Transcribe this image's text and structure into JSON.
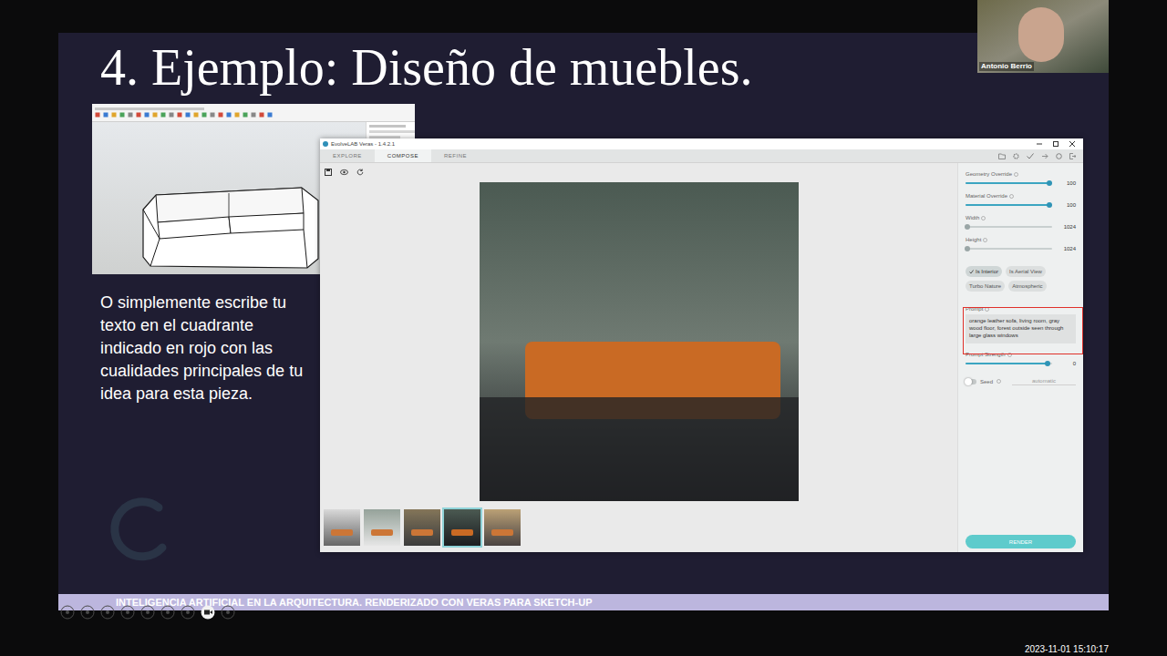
{
  "meeting": {
    "presenter": "Antonio Berrio",
    "timestamp": "2023-11-01  15:10:17"
  },
  "slide": {
    "title": "4. Ejemplo: Diseño de muebles.",
    "body": "O simplemente escribe tu texto en el cuadrante indicado en rojo con las cualidades principales de tu idea para esta pieza.",
    "footer": "INTELIGENCIA ARTIFICIAL EN LA ARQUITECTURA. RENDERIZADO CON VERAS PARA SKETCH-UP"
  },
  "veras": {
    "window": {
      "title": "EvolveLAB Veras - 1.4.2.1"
    },
    "tabs": [
      {
        "label": "EXPLORE",
        "selected": false
      },
      {
        "label": "COMPOSE",
        "selected": true
      },
      {
        "label": "REFINE",
        "selected": false
      }
    ],
    "sliders": [
      {
        "label": "Geometry Override",
        "value": "100",
        "level": 0.97
      },
      {
        "label": "Material Override",
        "value": "100",
        "level": 0.97
      },
      {
        "label": "Width",
        "value": "1024",
        "level": 0.02
      },
      {
        "label": "Height",
        "value": "1024",
        "level": 0.02
      }
    ],
    "options": [
      {
        "label": "Is Interior",
        "selected": true
      },
      {
        "label": "Is Aerial View",
        "selected": false
      },
      {
        "label": "Turbo Nature",
        "selected": false
      },
      {
        "label": "Atmospheric",
        "selected": false
      }
    ],
    "prompt": {
      "label": "Prompt",
      "value": "orange leather sofa, living room, gray wood floor, forest outside seen through large glass windows",
      "highlighted": true
    },
    "prompt_strength": {
      "label": "Prompt Strength",
      "value": "0",
      "level": 0.95
    },
    "seed": {
      "label": "Seed",
      "on": false,
      "value": "automatic"
    },
    "render_button": "RENDER",
    "thumbnails": [
      {
        "selected": false
      },
      {
        "selected": false
      },
      {
        "selected": false
      },
      {
        "selected": true
      },
      {
        "selected": false
      }
    ]
  }
}
